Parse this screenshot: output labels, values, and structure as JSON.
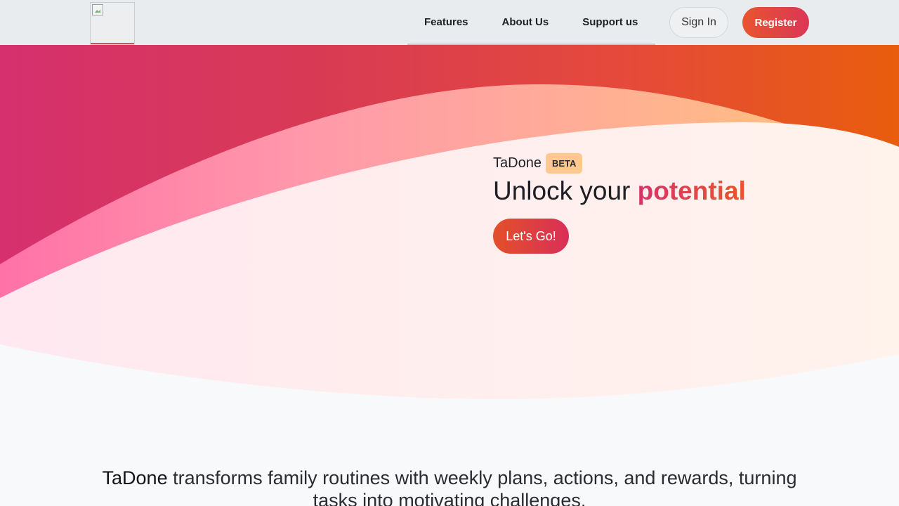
{
  "navbar": {
    "links": [
      "Features",
      "About Us",
      "Support us"
    ],
    "signin_label": "Sign In",
    "register_label": "Register"
  },
  "hero": {
    "brand": "TaDone",
    "badge": "BETA",
    "headline_prefix": "Unlock your ",
    "headline_accent": "potential",
    "cta_label": "Let's Go!"
  },
  "description": {
    "brand": "TaDone",
    "text": " transforms family routines with weekly plans, actions, and rewards, turning tasks into motivating challenges."
  },
  "colors": {
    "gradient_start": "#d6306e",
    "gradient_end": "#e85d0e",
    "accent_badge": "#ffc891",
    "page_background": "#f8f9fb"
  },
  "icons": {
    "logo": "broken-image-icon"
  }
}
